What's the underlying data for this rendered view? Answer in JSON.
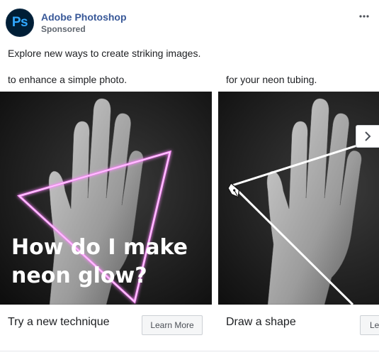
{
  "page": {
    "name": "Adobe Photoshop",
    "sponsored_label": "Sponsored",
    "avatar_text": "Ps",
    "more_icon": "more-horizontal-icon"
  },
  "post": {
    "message": "Explore new ways to create striking images."
  },
  "carousel": {
    "cards": [
      {
        "headline": "to enhance a simple photo.",
        "overlay_line1": "How do I make",
        "overlay_line2": "neon glow?",
        "title": "Try a new technique",
        "cta": "Learn More",
        "accent": "#ff8cff"
      },
      {
        "headline": "for your neon tubing.",
        "title": "Draw a shape",
        "cta": "Learn More",
        "accent": "#ffffff"
      }
    ],
    "next_icon": "chevron-right-icon"
  },
  "colors": {
    "link": "#385898",
    "ps_blue": "#31a8ff",
    "ps_navy": "#001e36"
  }
}
